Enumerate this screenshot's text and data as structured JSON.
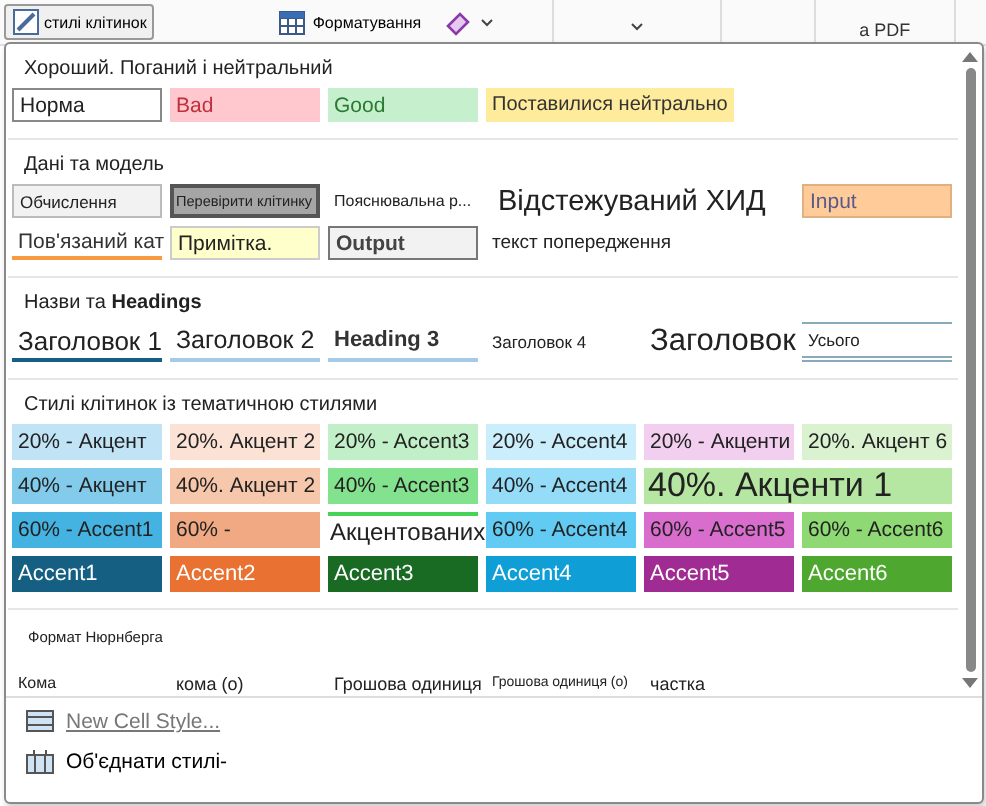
{
  "ribbon": {
    "styles_button": "стилі клітинок",
    "format_button": "Форматування",
    "pdf_label": "a PDF"
  },
  "sections": [
    {
      "title": "Хороший. Поганий і нейтральний",
      "rows": [
        [
          {
            "kind": "normal",
            "text": "Норма"
          },
          {
            "kind": "bad",
            "text": "Bad"
          },
          {
            "kind": "good",
            "text": "Good"
          },
          {
            "kind": "neutral",
            "text": "Поставилися нейтрально"
          }
        ]
      ]
    },
    {
      "title": "Дані та модель",
      "rows": [
        [
          {
            "kind": "calc",
            "text": "Обчислення"
          },
          {
            "kind": "check",
            "text": "Перевірити клітинку"
          },
          {
            "kind": "explain",
            "text": "Пояснювальна р..."
          },
          {
            "kind": "followed",
            "text": "Відстежуваний ХИД"
          },
          {
            "kind": "input",
            "text": "Input"
          }
        ],
        [
          {
            "kind": "linked",
            "text": "Пов'язаний кат"
          },
          {
            "kind": "note",
            "text": "Примітка."
          },
          {
            "kind": "output",
            "text": "Output"
          },
          {
            "kind": "warning",
            "text": "текст попередження"
          }
        ]
      ]
    },
    {
      "title": "Назви та **Headings**",
      "rows": [
        [
          {
            "kind": "h1",
            "text": "Заголовок 1"
          },
          {
            "kind": "h2",
            "text": "Заголовок 2"
          },
          {
            "kind": "h3",
            "text": "Heading 3"
          },
          {
            "kind": "h4",
            "text": "Заголовок 4"
          },
          {
            "kind": "title",
            "text": "Заголовок"
          },
          {
            "kind": "total",
            "text": "Усього"
          }
        ]
      ]
    },
    {
      "title": "Стилі клітинок із тематичною стилями",
      "rows": [
        [
          {
            "kind": "accent",
            "text": "20% - Акцент",
            "color": "#c0e4f5"
          },
          {
            "kind": "accent",
            "text": "20%. Акцент 2",
            "color": "#fbe2d5"
          },
          {
            "kind": "accent",
            "text": "20% - Accent3",
            "color": "#c1f0c8"
          },
          {
            "kind": "accent",
            "text": "20% - Accent4",
            "color": "#caeefb"
          },
          {
            "kind": "accent",
            "text": "20% - Акценти",
            "color": "#f2ceef"
          },
          {
            "kind": "accent",
            "text": "20%. Акцент 6",
            "color": "#daf2d0"
          }
        ],
        [
          {
            "kind": "accent",
            "text": "40% - Акцент",
            "color": "#83cbeb"
          },
          {
            "kind": "accent",
            "text": "40%. Акцент 2",
            "color": "#f7c7ac"
          },
          {
            "kind": "accent",
            "text": "40% - Accent3",
            "color": "#83e28e"
          },
          {
            "kind": "accent",
            "text": "40% - Accent4",
            "color": "#94dcf8"
          },
          {
            "kind": "split-big",
            "text": "40%. Акценти 1",
            "color": "#b5e6a2"
          }
        ],
        [
          {
            "kind": "accent",
            "text": "60% - Accent1",
            "color": "#44b3e1"
          },
          {
            "kind": "accent",
            "text": "60% -",
            "color": "#f1a983"
          },
          {
            "kind": "overlay",
            "text": "Акцентованих",
            "color": "#47d359"
          },
          {
            "kind": "accent",
            "text": "60% - Accent4",
            "color": "#61cbf3"
          },
          {
            "kind": "accent",
            "text": "60% - Accent5",
            "color": "#d86dcd"
          },
          {
            "kind": "accent",
            "text": "60% - Accent6",
            "color": "#8ed973"
          }
        ],
        [
          {
            "kind": "solid",
            "text": "Accent1",
            "color": "#156082"
          },
          {
            "kind": "solid",
            "text": "Accent2",
            "color": "#e97132"
          },
          {
            "kind": "solid",
            "text": "Accent3",
            "color": "#196b24"
          },
          {
            "kind": "solid",
            "text": "Accent4",
            "color": "#0f9ed5"
          },
          {
            "kind": "solid",
            "text": "Accent5",
            "color": "#a02b93"
          },
          {
            "kind": "solid",
            "text": "Accent6",
            "color": "#4ea72e"
          }
        ]
      ]
    },
    {
      "title": "Формат Нюрнберга",
      "small_title": true,
      "rows": [
        [
          {
            "kind": "num",
            "text": "Кома"
          },
          {
            "kind": "num-big",
            "text": "кома (о)"
          },
          {
            "kind": "num-big",
            "text": "Грошова одиниця"
          },
          {
            "kind": "num-small",
            "text": "Грошова одиниця (о)"
          },
          {
            "kind": "num-big",
            "text": "частка"
          }
        ]
      ]
    }
  ],
  "menu": [
    {
      "label": "New Cell Style...",
      "disabled": true
    },
    {
      "label": "Об'єднати стилі-",
      "disabled": false
    }
  ]
}
